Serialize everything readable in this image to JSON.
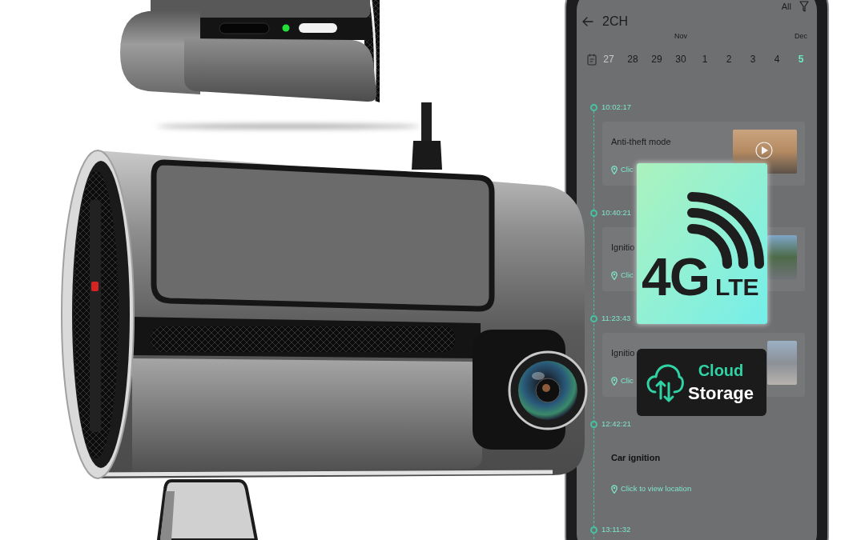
{
  "header": {
    "title": "2CH",
    "filter": "All"
  },
  "calendar": {
    "dates": [
      {
        "day": "27",
        "disabled": true,
        "selected": false
      },
      {
        "day": "28",
        "disabled": false,
        "selected": false
      },
      {
        "day": "29",
        "disabled": false,
        "selected": false
      },
      {
        "day": "30",
        "month": "Nov",
        "disabled": false,
        "selected": false
      },
      {
        "day": "1",
        "disabled": false,
        "selected": false
      },
      {
        "day": "2",
        "disabled": false,
        "selected": false
      },
      {
        "day": "3",
        "disabled": false,
        "selected": false
      },
      {
        "day": "4",
        "disabled": false,
        "selected": false
      },
      {
        "day": "5",
        "month": "Dec",
        "disabled": false,
        "selected": true
      }
    ]
  },
  "timeline": [
    {
      "time": "10:02:17",
      "kind": "clip",
      "title": "Anti-theft mode",
      "link": "Clic"
    },
    {
      "time": "10:40:21",
      "kind": "clip",
      "title": "Ignitio",
      "link": "Clic"
    },
    {
      "time": "11:23:43",
      "kind": "clip",
      "title": "Ignitio",
      "link": "Clic"
    },
    {
      "time": "12:42:21",
      "kind": "event",
      "title": "Car ignition",
      "link": "Click to view location"
    },
    {
      "time": "13:11:32",
      "kind": "event"
    }
  ],
  "badges": [
    {
      "kind": "network",
      "title": "4G",
      "subtitle": "LTE"
    },
    {
      "kind": "cloud",
      "title": "Cloud",
      "subtitle": "Storage"
    }
  ]
}
